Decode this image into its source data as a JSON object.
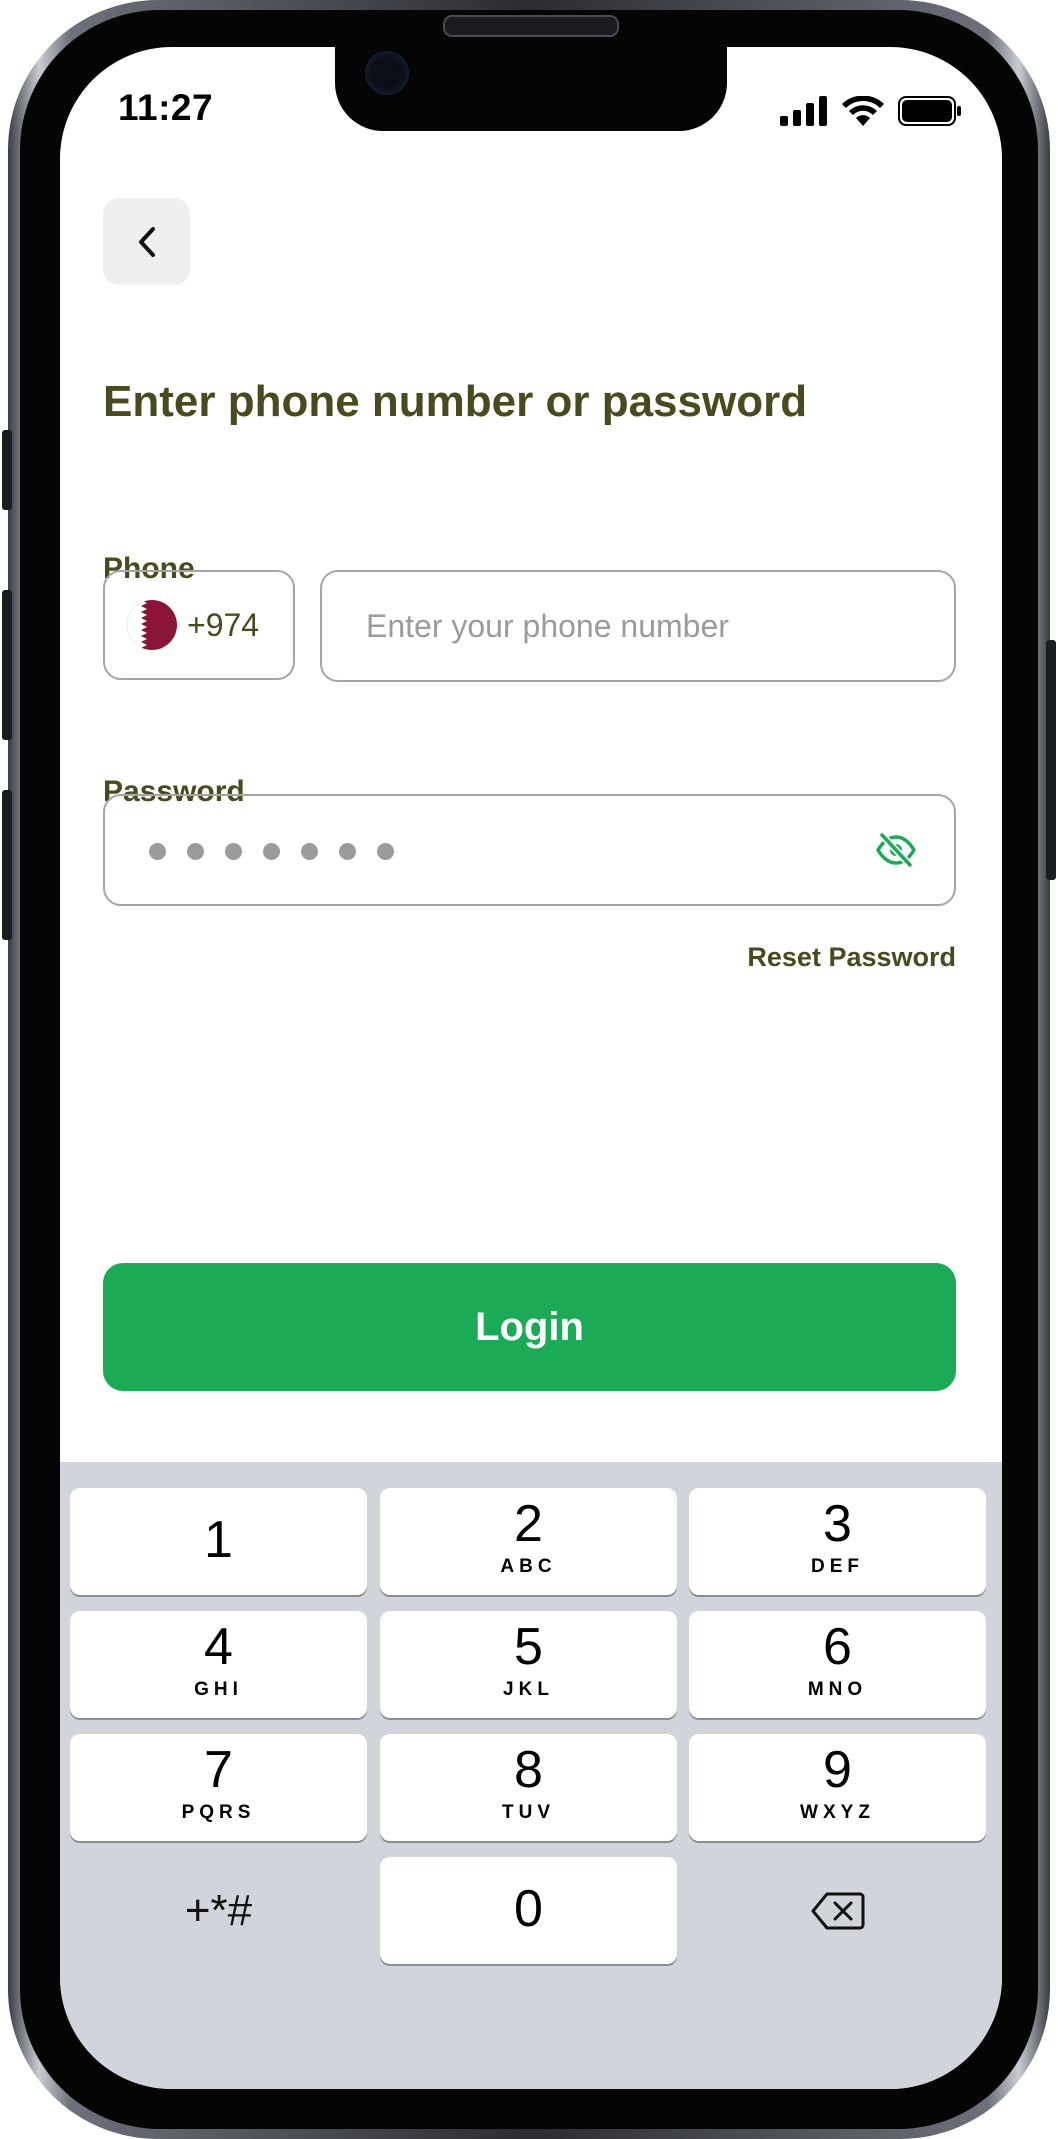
{
  "status_bar": {
    "time": "11:27"
  },
  "header": {
    "back_icon": "chevron-left-icon"
  },
  "title": "Enter phone number or password",
  "phone": {
    "label": "Phone",
    "country_flag": "qatar-flag-icon",
    "country_code": "+974",
    "placeholder": "Enter your phone number"
  },
  "password": {
    "label": "Password",
    "masked_length": 7,
    "toggle_icon": "eye-off-icon"
  },
  "reset_link": "Reset Password",
  "login_button": "Login",
  "colors": {
    "accent": "#1baa55",
    "text_dark": "#4a4a1f",
    "border": "#a5a5a5",
    "keyboard_bg": "#d1d4da"
  },
  "keyboard": {
    "keys": [
      {
        "num": "1",
        "letters": ""
      },
      {
        "num": "2",
        "letters": "ABC"
      },
      {
        "num": "3",
        "letters": "DEF"
      },
      {
        "num": "4",
        "letters": "GHI"
      },
      {
        "num": "5",
        "letters": "JKL"
      },
      {
        "num": "6",
        "letters": "MNO"
      },
      {
        "num": "7",
        "letters": "PQRS"
      },
      {
        "num": "8",
        "letters": "TUV"
      },
      {
        "num": "9",
        "letters": "WXYZ"
      }
    ],
    "symbols": "+*#",
    "zero": "0",
    "delete_icon": "backspace-icon"
  }
}
